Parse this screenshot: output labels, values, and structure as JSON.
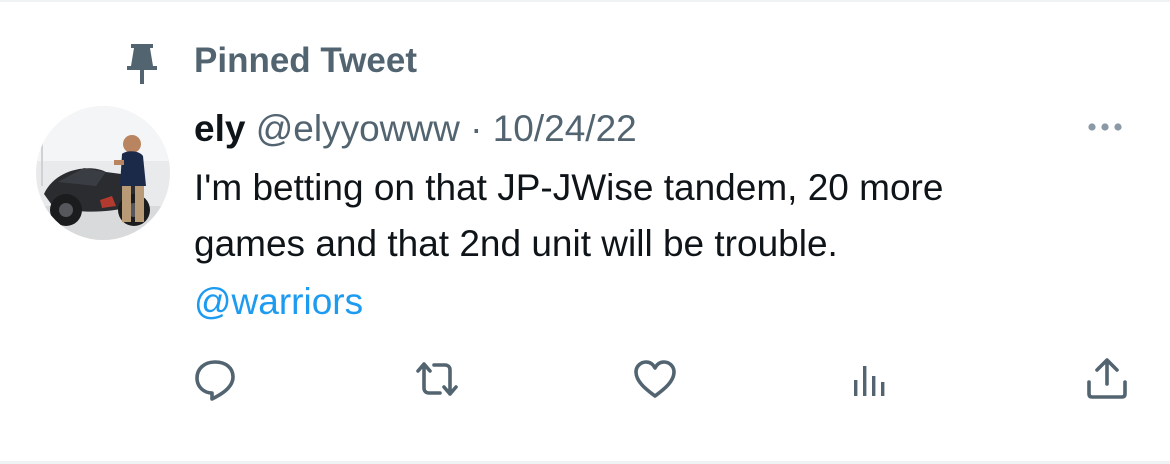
{
  "pinned": {
    "label": "Pinned Tweet",
    "icon": "pin-icon"
  },
  "tweet": {
    "display_name": "ely",
    "handle": "@elyyowww",
    "separator": "·",
    "date": "10/24/22",
    "text_lines": [
      "I'm betting on that JP-JWise tandem, 20 more",
      "games and that 2nd unit will be trouble."
    ],
    "mention": "@warriors"
  },
  "actions": {
    "reply": "reply-icon",
    "retweet": "retweet-icon",
    "like": "like-icon",
    "views": "views-icon",
    "share": "share-icon",
    "more": "more-icon"
  },
  "colors": {
    "text": "#0f1419",
    "secondary": "#536471",
    "link": "#1d9bf0",
    "divider": "#eff3f4"
  }
}
